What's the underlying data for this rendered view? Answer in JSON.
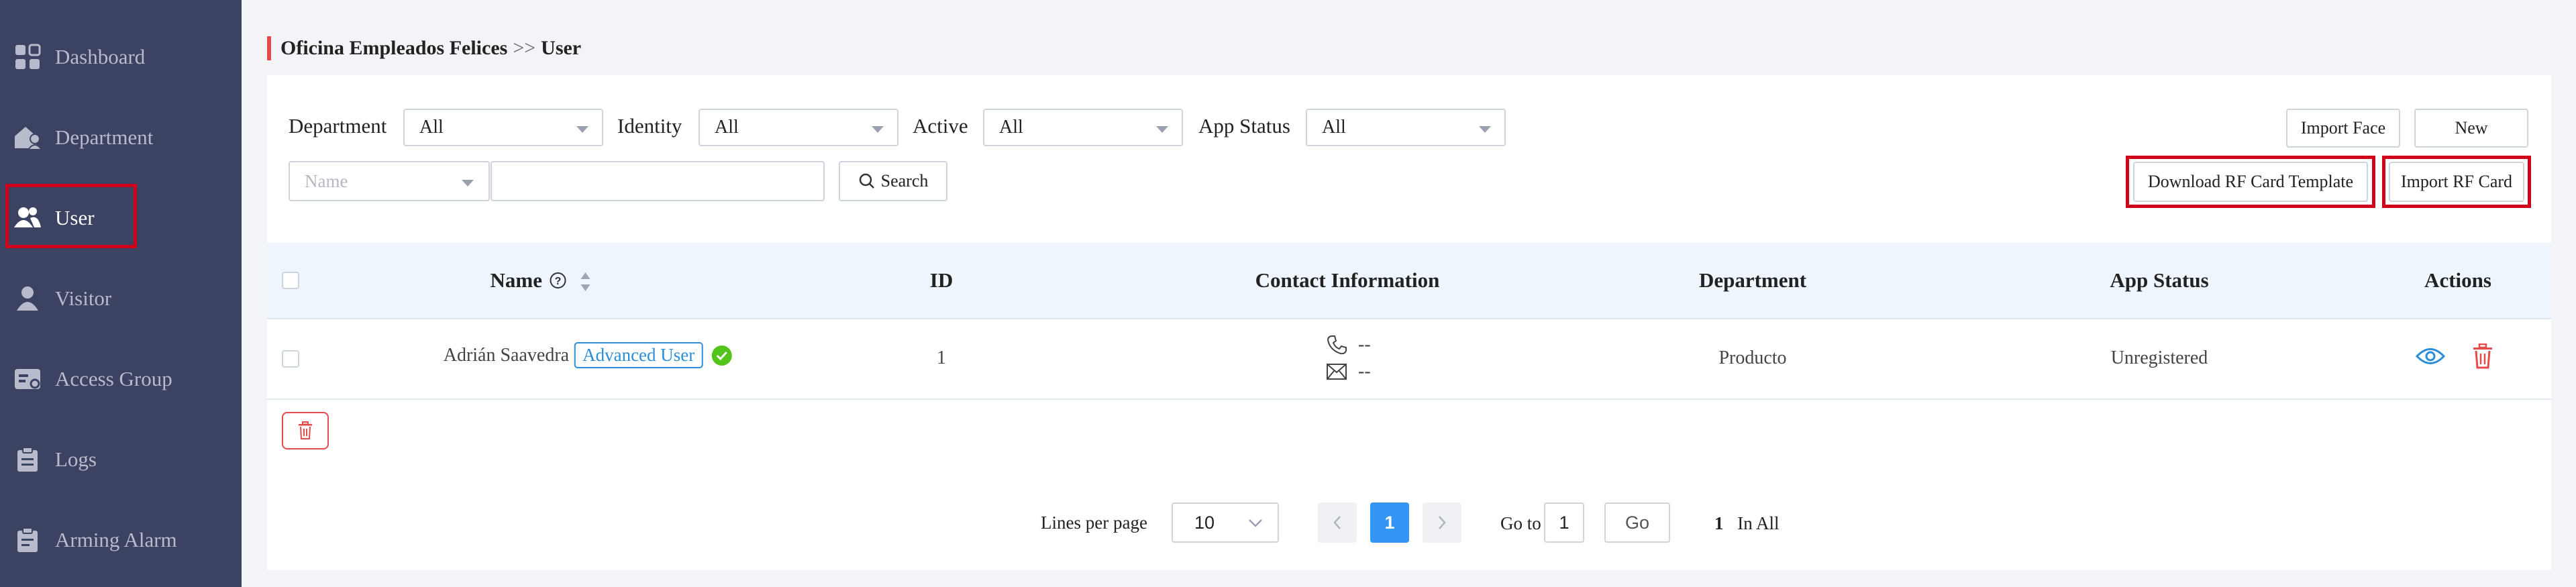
{
  "sidebar": {
    "items": [
      {
        "label": "Dashboard",
        "icon": "dashboard-icon"
      },
      {
        "label": "Department",
        "icon": "department-icon"
      },
      {
        "label": "User",
        "icon": "user-icon",
        "active": true
      },
      {
        "label": "Visitor",
        "icon": "visitor-icon"
      },
      {
        "label": "Access Group",
        "icon": "access-group-icon"
      },
      {
        "label": "Logs",
        "icon": "logs-icon"
      },
      {
        "label": "Arming Alarm",
        "icon": "arming-alarm-icon"
      }
    ]
  },
  "breadcrumb": {
    "parent": "Oficina Empleados Felices",
    "separator": ">>",
    "current": "User"
  },
  "filters": {
    "department": {
      "label": "Department",
      "value": "All"
    },
    "identity": {
      "label": "Identity",
      "value": "All"
    },
    "active": {
      "label": "Active",
      "value": "All"
    },
    "app_status": {
      "label": "App Status",
      "value": "All"
    },
    "search_field": {
      "placeholder": "Name"
    },
    "search_input": {
      "value": ""
    },
    "search_button": "Search"
  },
  "actions": {
    "import_face": "Import Face",
    "new": "New",
    "download_rf_template": "Download RF Card Template",
    "import_rf_card": "Import RF Card"
  },
  "table": {
    "columns": [
      "Name",
      "ID",
      "Contact Information",
      "Department",
      "App Status",
      "Actions"
    ],
    "rows": [
      {
        "name": "Adrián Saavedra",
        "role": "Advanced User",
        "id": "1",
        "phone": "--",
        "email": "--",
        "department": "Producto",
        "app_status": "Unregistered"
      }
    ]
  },
  "pagination": {
    "lines_per_page_label": "Lines per page",
    "lines_per_page": "10",
    "current_page": "1",
    "goto_label": "Go to",
    "goto_value": "1",
    "go_button": "Go",
    "total": "1",
    "total_label": "In All"
  },
  "colors": {
    "sidebar": "#3c4262",
    "accent": "#2b8ed9",
    "danger": "#e64b4b",
    "highlight": "#d0021b",
    "success": "#52c41a"
  }
}
